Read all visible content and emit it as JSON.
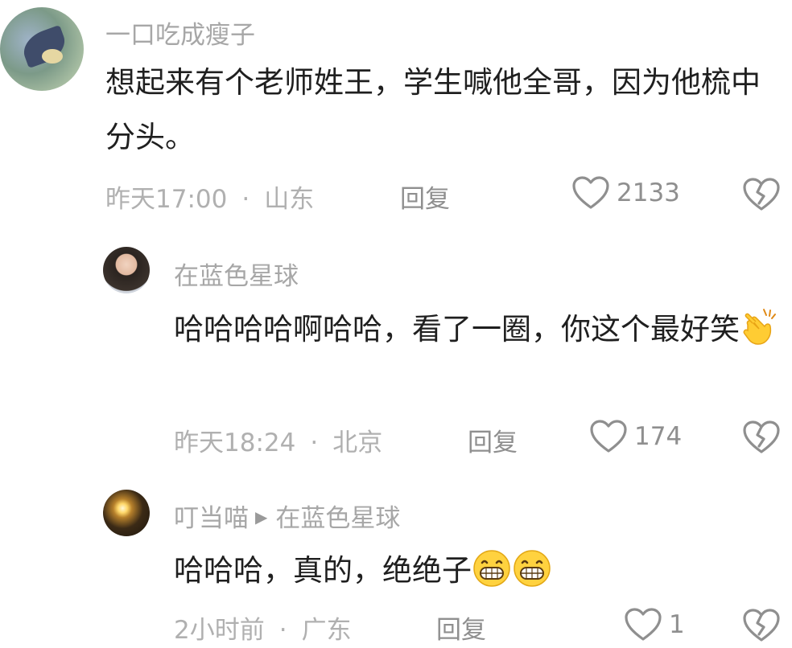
{
  "comments": [
    {
      "username": "一口吃成瘦子",
      "text": "想起来有个老师姓王，学生喊他全哥，因为他梳中分头。",
      "time": "昨天17:00",
      "location": "山东",
      "reply_label": "回复",
      "likes": "2133"
    },
    {
      "username": "在蓝色星球",
      "text": "哈哈哈哈啊哈哈，看了一圈，你这个最好笑",
      "time": "昨天18:24",
      "location": "北京",
      "reply_label": "回复",
      "likes": "174",
      "emoji": "clapping-hands"
    },
    {
      "username": "叮当喵",
      "reply_to": "在蓝色星球",
      "text": "哈哈哈，真的，绝绝子",
      "time": "2小时前",
      "location": "广东",
      "reply_label": "回复",
      "likes": "1",
      "emoji": "grinning-face"
    }
  ],
  "separator": "·",
  "icons": {
    "like": "heart-outline-icon",
    "dislike": "broken-heart-icon",
    "reply_arrow": "triangle-right-icon"
  },
  "colors": {
    "text": "#1f1f1f",
    "meta": "#b0b0b0",
    "username": "#a7a7a7"
  }
}
